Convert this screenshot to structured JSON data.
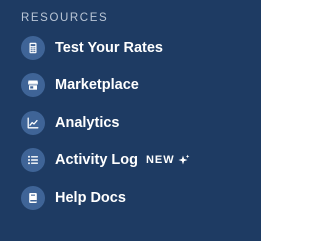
{
  "resources": {
    "title": "RESOURCES",
    "items": [
      {
        "label": "Test Your Rates",
        "icon": "calculator-icon"
      },
      {
        "label": "Marketplace",
        "icon": "store-icon"
      },
      {
        "label": "Analytics",
        "icon": "line-chart-icon"
      },
      {
        "label": "Activity Log",
        "icon": "list-icon",
        "badge": "NEW",
        "badge_icon": "sparkle-icon"
      },
      {
        "label": "Help Docs",
        "icon": "book-icon"
      }
    ]
  },
  "colors": {
    "panel_background": "#1e3b63",
    "icon_circle": "#3f6497",
    "title_text": "#bac6d6",
    "item_text": "#ffffff"
  }
}
